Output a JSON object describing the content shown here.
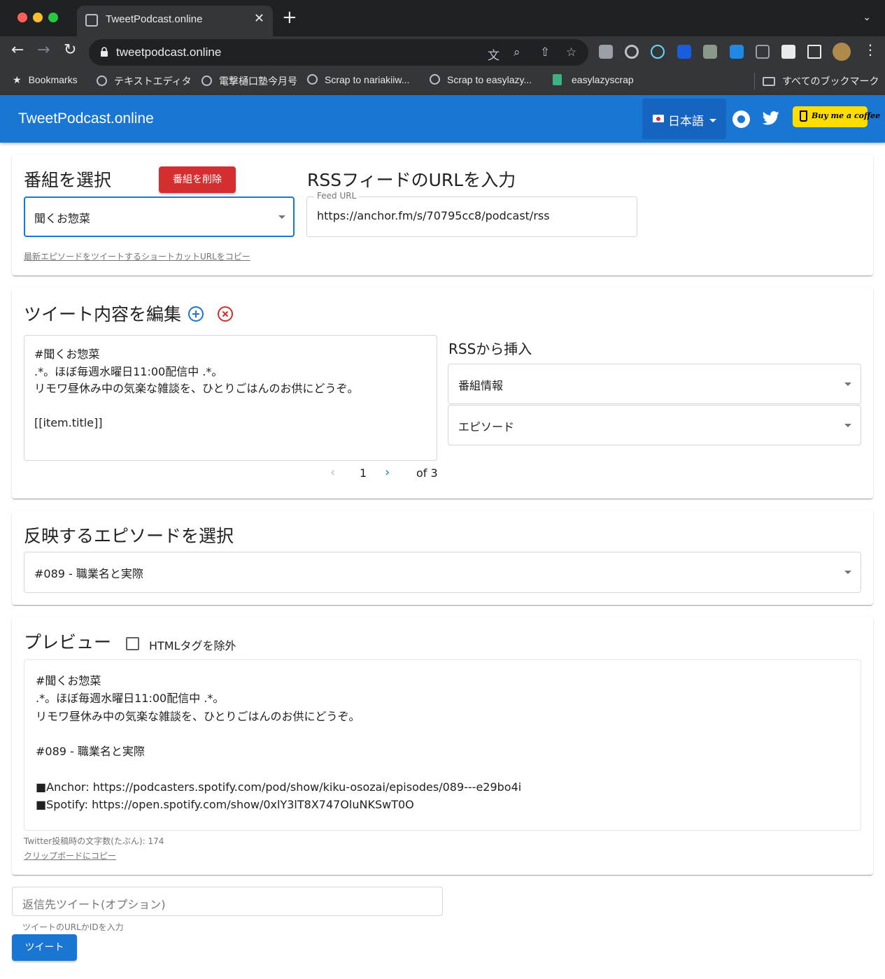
{
  "browser": {
    "tab_title": "TweetPodcast.online",
    "url": "tweetpodcast.online",
    "bookmarks": [
      {
        "label": "Bookmarks"
      },
      {
        "label": "テキストエディタ"
      },
      {
        "label": "電撃樋口塾今月号"
      },
      {
        "label": "Scrap to nariakiiw..."
      },
      {
        "label": "Scrap to easylazy..."
      },
      {
        "label": "easylazyscrap"
      }
    ],
    "all_bookmarks": "すべてのブックマーク"
  },
  "app": {
    "title": "TweetPodcast.online",
    "language": "日本語",
    "coffee_label": "Buy me a coffee"
  },
  "program": {
    "heading": "番組を選択",
    "delete_label": "番組を削除",
    "selected": "聞くお惣菜",
    "shortcut_link": "最新エピソードをツイートするショートカットURLをコピー",
    "rss_heading": "RSSフィードのURLを入力",
    "feed_label": "Feed URL",
    "feed_url": "https://anchor.fm/s/70795cc8/podcast/rss"
  },
  "editor": {
    "heading": "ツイート内容を編集",
    "text": "#聞くお惣菜\n.*。ほぼ毎週水曜日11:00配信中 .*。\nリモワ昼休み中の気楽な雑談を、ひとりごはんのお供にどうぞ。\n\n[[item.title]]",
    "insert_heading": "RSSから挿入",
    "insert_program": "番組情報",
    "insert_episode": "エピソード",
    "page_current": "1",
    "page_total": "of 3"
  },
  "episode": {
    "heading": "反映するエピソードを選択",
    "selected": "#089 - 職業名と実際"
  },
  "preview": {
    "heading": "プレビュー",
    "strip_html_label": "HTMLタグを除外",
    "strip_html_checked": false,
    "text": "#聞くお惣菜\n.*。ほぼ毎週水曜日11:00配信中 .*。\nリモワ昼休み中の気楽な雑談を、ひとりごはんのお供にどうぞ。\n\n#089 - 職業名と実際\n\n■Anchor: https://podcasters.spotify.com/pod/show/kiku-osozai/episodes/089---e29bo4i\n■Spotify: https://open.spotify.com/show/0xlY3lT8X747OluNKSwT0O",
    "char_count": "Twitter投稿時の文字数(たぶん): 174",
    "copy_link": "クリップボードにコピー"
  },
  "reply": {
    "placeholder": "返信先ツイート(オプション)",
    "hint": "ツイートのURLかIDを入力",
    "tweet_label": "ツイート"
  },
  "colors": {
    "primary": "#1976d2",
    "danger": "#d32f2f",
    "coffee": "#ffdd00"
  }
}
